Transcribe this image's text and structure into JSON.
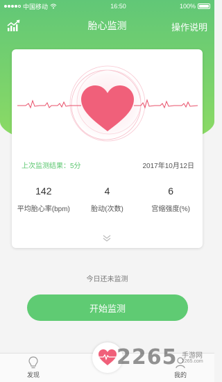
{
  "status_bar": {
    "carrier": "中国移动",
    "time": "16:50",
    "battery": "100%"
  },
  "nav": {
    "title": "胎心监测",
    "right_action": "操作说明"
  },
  "card": {
    "result_label": "上次监测结果：5分",
    "result_date": "2017年10月12日",
    "stats": [
      {
        "value": "142",
        "label": "平均胎心率(bpm)"
      },
      {
        "value": "4",
        "label": "胎动(次数)"
      },
      {
        "value": "6",
        "label": "宫缩强度(%)"
      }
    ]
  },
  "today_status": "今日还未监测",
  "start_button": "开始监测",
  "tabbar": {
    "tab_discover": "发现",
    "tab_mine": "我的"
  },
  "watermark": {
    "brand": "2265",
    "site": "手游网",
    "url": "2265.com"
  },
  "colors": {
    "primary_green": "#5fcb73",
    "heart_pink": "#f0607a",
    "ecg_line": "#e8506a"
  }
}
